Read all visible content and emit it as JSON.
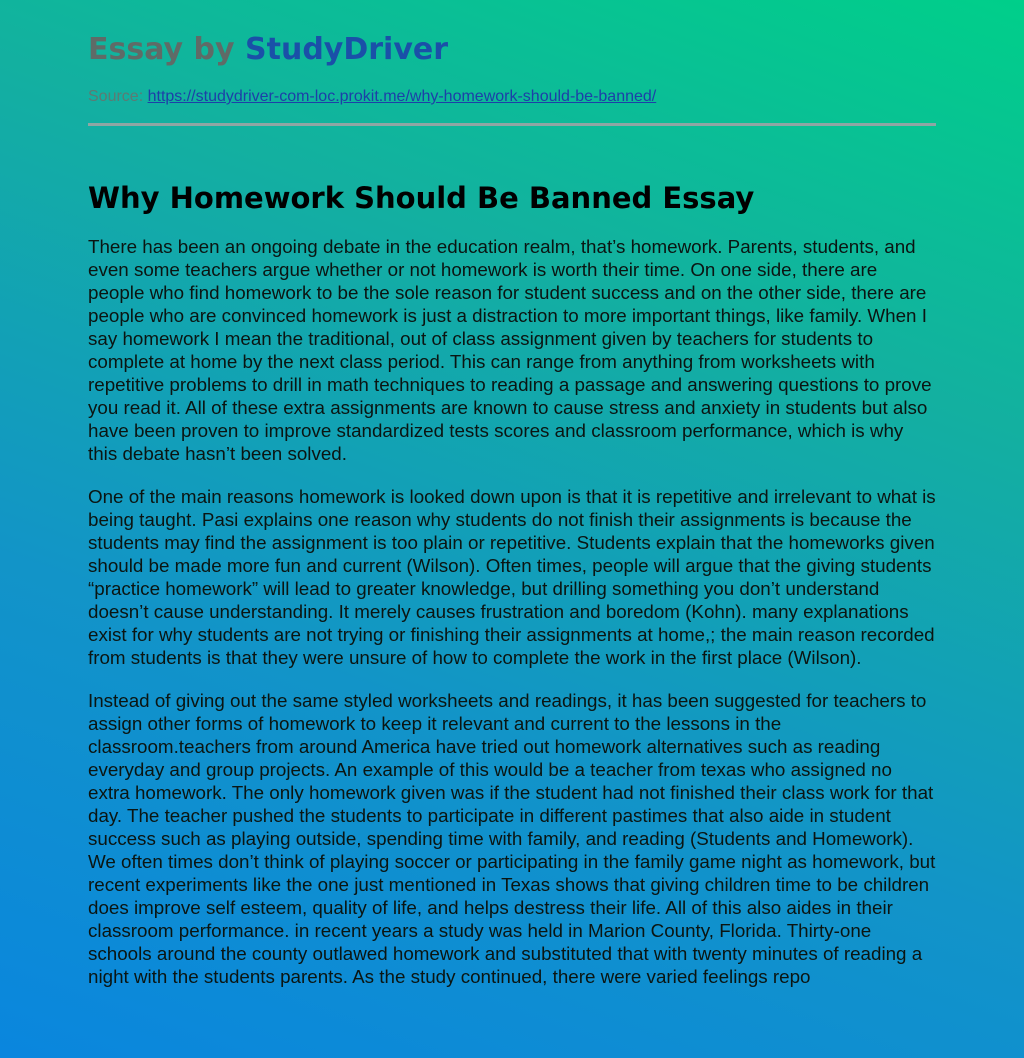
{
  "header": {
    "brand_prefix": "Essay by",
    "brand_name": "StudyDriver",
    "source_label": "Source:",
    "source_url": "https://studydriver-com-loc.prokit.me/why-homework-should-be-banned/"
  },
  "article": {
    "title": "Why Homework Should Be Banned Essay",
    "paragraphs": [
      "There has been an ongoing debate in the education realm, that’s homework. Parents, students, and even some teachers argue whether or not homework is worth their time. On one side, there are people who find homework to be the sole reason for student success and on the other side, there are people who are convinced homework is just a distraction to more important things, like family. When I say homework I mean the traditional, out of class assignment given by teachers for students to complete at home by the next class period. This can range from anything from worksheets with repetitive problems to drill in math techniques to reading a passage and answering questions to prove you read it. All of these extra assignments are known to cause stress and anxiety in students but also have been proven to improve standardized tests scores and classroom performance, which is why this debate hasn’t been solved.",
      "One of the main reasons homework is looked down upon is that it is repetitive and irrelevant to what is being taught. Pasi explains one reason why students do not finish their assignments is because the students may find the assignment is too plain or repetitive. Students explain that the homeworks given should be made more fun and current (Wilson). Often times, people will argue that the giving students “practice homework” will lead to greater knowledge, but drilling something you don’t understand doesn’t cause understanding. It merely causes frustration and boredom (Kohn). many explanations exist for why students are not trying or finishing their assignments at home,; the main reason recorded from students is that they were unsure of how to complete the work in the first place (Wilson).",
      "Instead of giving out the same styled worksheets and readings, it has been suggested for teachers to assign other forms of homework to keep it relevant and current to the lessons in the classroom.teachers from around America have tried out homework alternatives such as reading everyday and group projects. An example of this would be a teacher from texas who assigned no extra homework. The only homework given was if the student had not finished their class work for that day. The teacher pushed the students to participate in different pastimes that also aide in student success such as playing outside, spending time with family, and reading (Students and Homework). We often times don’t think of playing soccer or participating in the family game night as homework, but recent experiments like the one just mentioned in Texas shows that giving children time to be children does improve self esteem, quality of life, and helps destress their life. All of this also aides in their classroom performance. in recent years a study was held in Marion County, Florida. Thirty-one schools around the county outlawed homework and substituted that with twenty minutes of reading a night with the students parents. As the study continued, there were varied feelings repo"
    ]
  }
}
